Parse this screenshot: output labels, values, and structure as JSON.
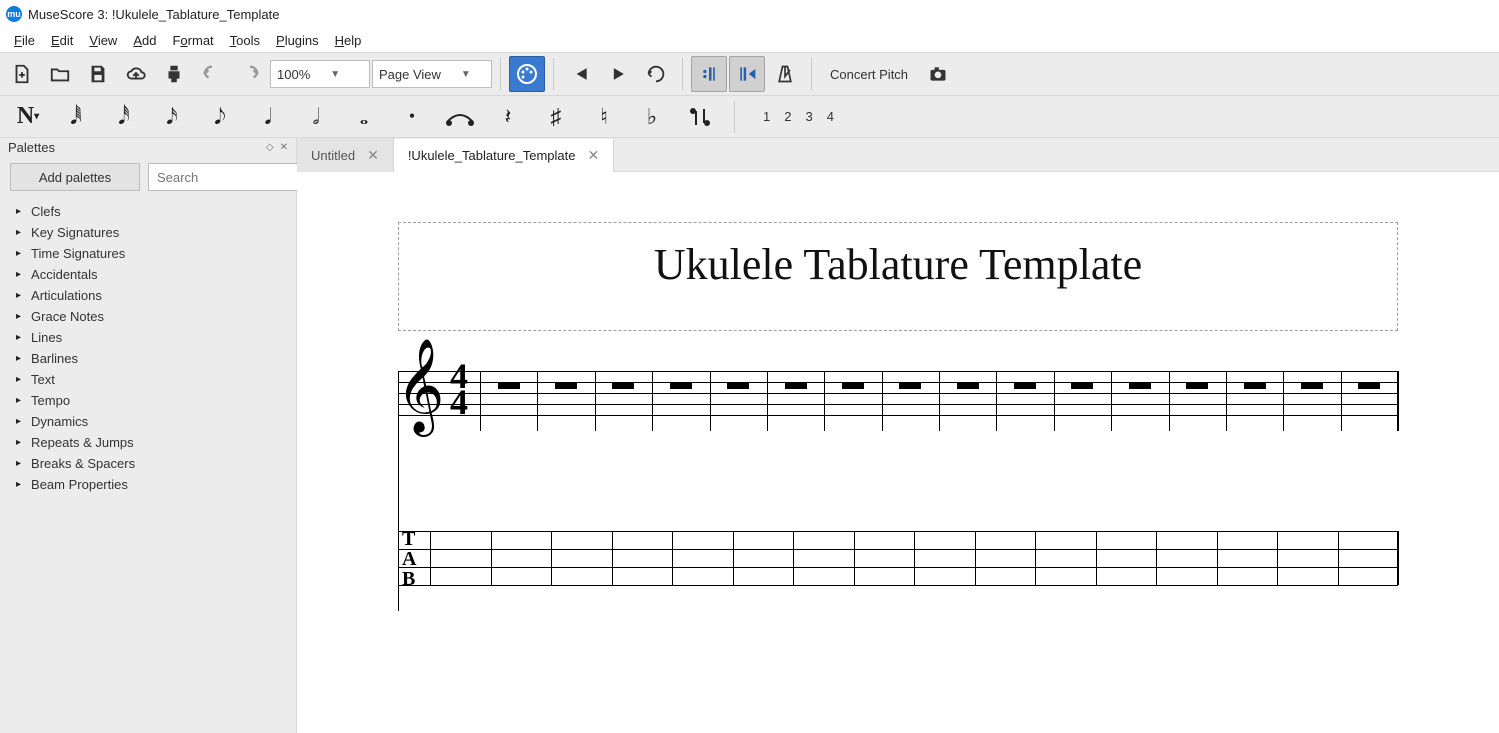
{
  "app": {
    "title": "MuseScore 3: !Ukulele_Tablature_Template"
  },
  "menu": {
    "items": [
      "File",
      "Edit",
      "View",
      "Add",
      "Format",
      "Tools",
      "Plugins",
      "Help"
    ]
  },
  "toolbar": {
    "zoom": "100%",
    "layout": "Page View",
    "concert_pitch": "Concert Pitch"
  },
  "notebar": {
    "voices": [
      "1",
      "2",
      "3",
      "4"
    ]
  },
  "palettes": {
    "title": "Palettes",
    "add_button": "Add palettes",
    "search_placeholder": "Search",
    "items": [
      "Clefs",
      "Key Signatures",
      "Time Signatures",
      "Accidentals",
      "Articulations",
      "Grace Notes",
      "Lines",
      "Barlines",
      "Text",
      "Tempo",
      "Dynamics",
      "Repeats & Jumps",
      "Breaks & Spacers",
      "Beam Properties"
    ]
  },
  "tabs": [
    {
      "label": "Untitled",
      "active": false
    },
    {
      "label": "!Ukulele_Tablature_Template",
      "active": true
    }
  ],
  "score": {
    "title": "Ukulele Tablature Template",
    "timesig_top": "4",
    "timesig_bottom": "4",
    "tab_letters": [
      "T",
      "A",
      "B"
    ],
    "measures": 16
  }
}
